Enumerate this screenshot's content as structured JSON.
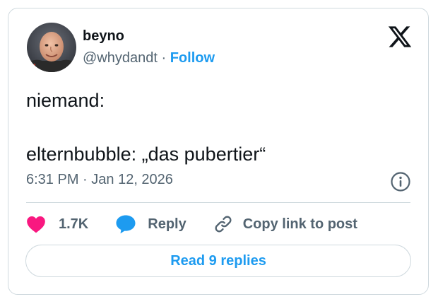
{
  "author": {
    "name": "beyno",
    "handle": "@whydandt",
    "separator": " · ",
    "follow_label": "Follow"
  },
  "brand_icon": "x-logo-icon",
  "tweet": {
    "lines": [
      "niemand:",
      "elternbubble: „das pubertier“"
    ],
    "time": "6:31 PM",
    "date_separator": " · ",
    "date": "Jan 12, 2026"
  },
  "actions": {
    "like_count": "1.7K",
    "reply_label": "Reply",
    "copy_label": "Copy link to post",
    "read_replies_label": "Read 9 replies"
  },
  "icons": {
    "like": "heart-icon",
    "reply": "speech-bubble-icon",
    "copy": "link-icon",
    "info": "info-icon"
  },
  "colors": {
    "accent": "#1d9bf0",
    "heart": "#f91880",
    "text": "#0f1419",
    "secondary": "#536471",
    "border": "#cfd9de"
  }
}
